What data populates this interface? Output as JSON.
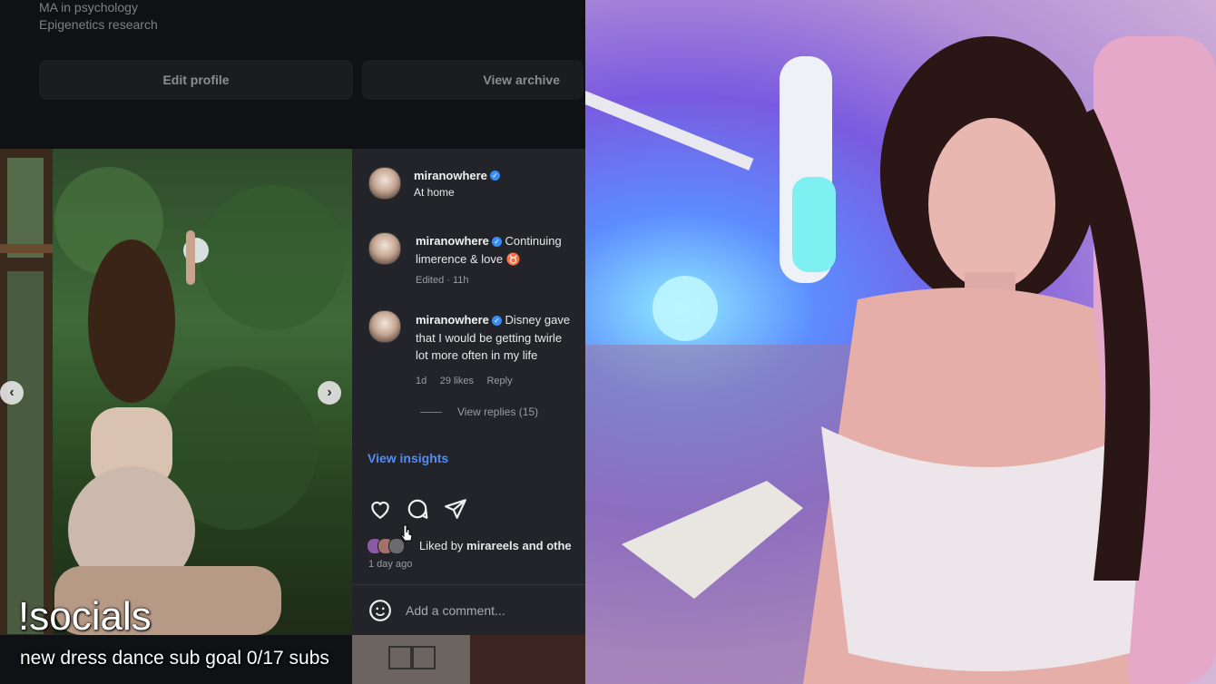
{
  "profile": {
    "bio_line1": "MA in psychology",
    "bio_line2": "Epigenetics research",
    "edit_profile_label": "Edit profile",
    "view_archive_label": "View archive"
  },
  "post": {
    "username": "miranowhere",
    "location": "At home",
    "comments": [
      {
        "username": "miranowhere",
        "text_line1": "Continuing",
        "text_line2": "limerence & love ♉",
        "time": "Edited · 11h"
      },
      {
        "username": "miranowhere",
        "text_line1": "Disney gave",
        "text_line2": "that I would be getting twirle",
        "text_line3": "lot more often in my life",
        "time": "1d",
        "likes": "29 likes",
        "reply_label": "Reply",
        "view_replies": "View replies (15)"
      }
    ],
    "view_insights": "View insights",
    "liked_by_prefix": "Liked by",
    "liked_by_user": "mirareels",
    "liked_by_suffix": "and othe",
    "posted_time": "1 day ago",
    "comment_placeholder": "Add a comment..."
  },
  "overlay": {
    "title": "!socials",
    "subtitle": "new dress dance sub goal 0/17 subs"
  },
  "icons": {
    "heart": "heart-icon",
    "comment": "comment-icon",
    "share": "send-icon",
    "emoji": "emoji-icon",
    "verified": "verified-badge-icon"
  },
  "colors": {
    "link_blue": "#4f8ef7",
    "verified_blue": "#3a8cf5"
  }
}
